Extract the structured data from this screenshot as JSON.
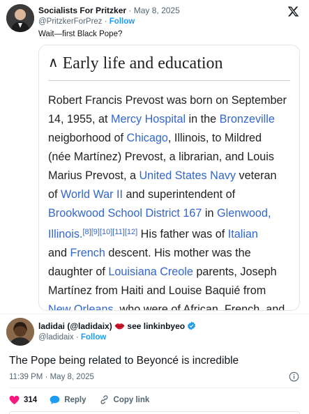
{
  "tweet1": {
    "name": "Socialists For Pritzker",
    "date": "· May 8, 2025",
    "handle": "@PritzkerForPrez · ",
    "follow": "Follow",
    "text": "Wait—first Black Pope?"
  },
  "wiki": {
    "heading": "Early life and education",
    "chevron": "^",
    "lines": [
      [
        {
          "t": "Robert Francis Prevost was born on September"
        }
      ],
      [
        {
          "t": "14, 1955, at "
        },
        {
          "t": "Mercy Hospital",
          "l": true
        },
        {
          "t": " in the "
        },
        {
          "t": "Bronzeville",
          "l": true
        }
      ],
      [
        {
          "t": "neigborhood of "
        },
        {
          "t": "Chicago",
          "l": true
        },
        {
          "t": ", Illinois, to Mildred"
        }
      ],
      [
        {
          "t": "(née Martínez) Prevost, a librarian, and Louis"
        }
      ],
      [
        {
          "t": "Marius Prevost, a "
        },
        {
          "t": "United States Navy",
          "l": true
        },
        {
          "t": " veteran"
        }
      ],
      [
        {
          "t": "of "
        },
        {
          "t": "World War II",
          "l": true
        },
        {
          "t": " and superintendent of"
        }
      ],
      [
        {
          "t": "Brookwood School District 167",
          "l": true
        },
        {
          "t": " in "
        },
        {
          "t": "Glenwood,",
          "l": true
        }
      ],
      [
        {
          "t": "Illinois.",
          "l": true
        },
        {
          "t": "[8][9][10][11][12]",
          "s": true
        },
        {
          "t": " His father was of "
        },
        {
          "t": "Italian",
          "l": true
        }
      ],
      [
        {
          "t": "and "
        },
        {
          "t": "French",
          "l": true
        },
        {
          "t": " descent. His mother was the"
        }
      ],
      [
        {
          "t": "daughter of "
        },
        {
          "t": "Louisiana Creole",
          "l": true
        },
        {
          "t": " parents, Joseph"
        }
      ],
      [
        {
          "t": "Martínez from Haiti and Louise Baquié from"
        }
      ],
      [
        {
          "t": "New Orleans,",
          "l": true
        },
        {
          "t": " who were of African, French, and"
        }
      ]
    ]
  },
  "tweet2": {
    "name": "ladidai (@ladidaix) ",
    "name_suffix": " see linkinbyeo",
    "handle": "@ladidaix · ",
    "follow": "Follow",
    "text": "The Pope being related to Beyoncé is incredible",
    "timestamp": "11:39 PM · May 8, 2025",
    "likes": "314",
    "reply": "Reply",
    "copy_link": "Copy link"
  },
  "colors": {
    "link": "#3366cc",
    "accent": "#1d9bf0",
    "like": "#f91880",
    "verified": "#1d9bf0"
  },
  "icons": [
    "x-logo-icon",
    "chevron-up-icon",
    "lips-icon",
    "verified-icon",
    "info-icon",
    "heart-icon",
    "reply-icon",
    "link-icon"
  ]
}
